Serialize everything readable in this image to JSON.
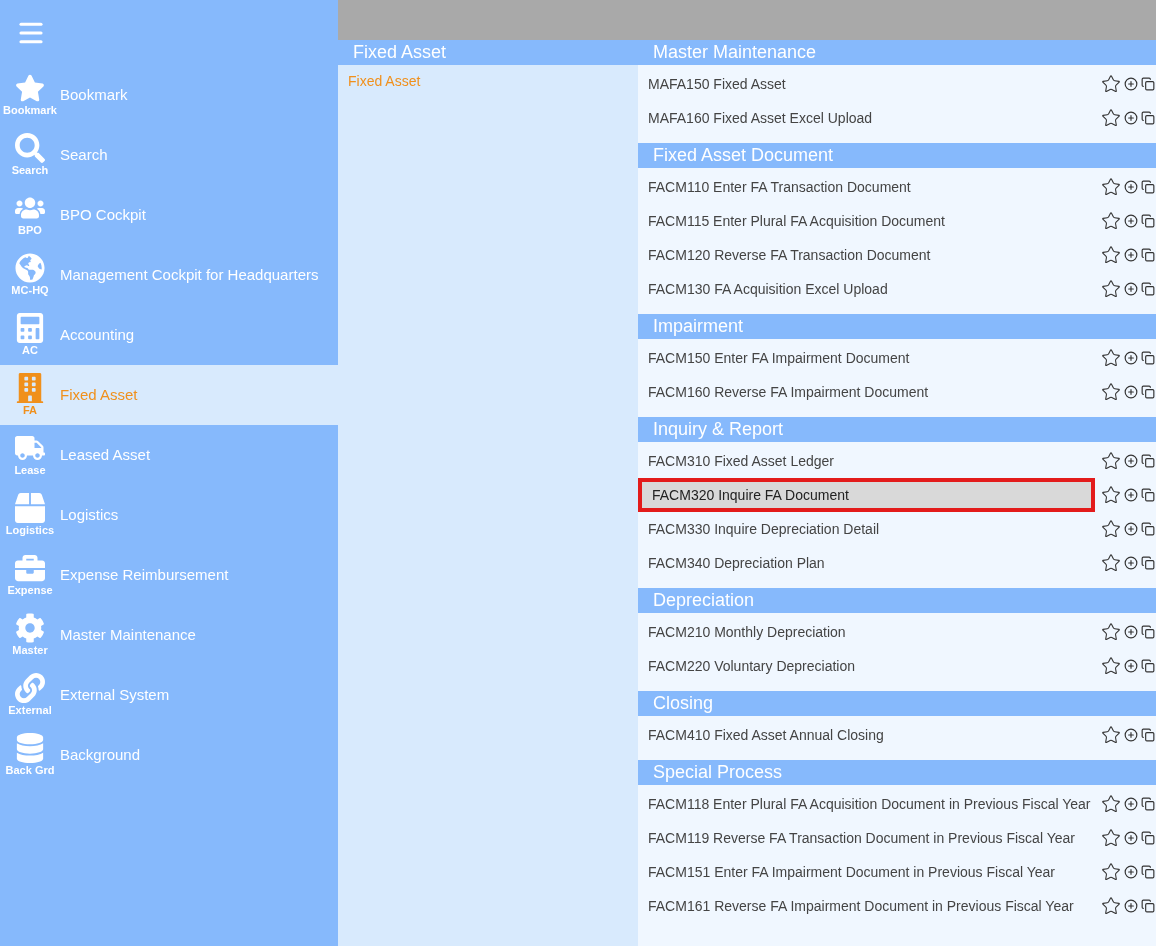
{
  "sidebar": {
    "items": [
      {
        "short_label": "Bookmark",
        "label": "Bookmark",
        "selected": false
      },
      {
        "short_label": "Search",
        "label": "Search",
        "selected": false
      },
      {
        "short_label": "BPO",
        "label": "BPO Cockpit",
        "selected": false
      },
      {
        "short_label": "MC-HQ",
        "label": "Management Cockpit for Headquarters",
        "selected": false
      },
      {
        "short_label": "AC",
        "label": "Accounting",
        "selected": false
      },
      {
        "short_label": "FA",
        "label": "Fixed Asset",
        "selected": true
      },
      {
        "short_label": "Lease",
        "label": "Leased Asset",
        "selected": false
      },
      {
        "short_label": "Logistics",
        "label": "Logistics",
        "selected": false
      },
      {
        "short_label": "Expense",
        "label": "Expense Reimbursement",
        "selected": false
      },
      {
        "short_label": "Master",
        "label": "Master Maintenance",
        "selected": false
      },
      {
        "short_label": "External",
        "label": "External System",
        "selected": false
      },
      {
        "short_label": "Back Grd",
        "label": "Background",
        "selected": false
      }
    ]
  },
  "category_panel": {
    "title": "Fixed Asset",
    "items": [
      {
        "label": "Fixed Asset",
        "selected": true
      }
    ]
  },
  "menu_sections": [
    {
      "title": "Master Maintenance",
      "items": [
        {
          "label": "MAFA150 Fixed Asset",
          "selected": false
        },
        {
          "label": "MAFA160 Fixed Asset Excel Upload",
          "selected": false
        }
      ]
    },
    {
      "title": "Fixed Asset Document",
      "items": [
        {
          "label": "FACM110 Enter FA Transaction Document",
          "selected": false
        },
        {
          "label": "FACM115 Enter Plural FA Acquisition Document",
          "selected": false
        },
        {
          "label": "FACM120 Reverse FA Transaction Document",
          "selected": false
        },
        {
          "label": "FACM130 FA Acquisition Excel Upload",
          "selected": false
        }
      ]
    },
    {
      "title": "Impairment",
      "items": [
        {
          "label": "FACM150 Enter FA Impairment Document",
          "selected": false
        },
        {
          "label": "FACM160 Reverse FA Impairment Document",
          "selected": false
        }
      ]
    },
    {
      "title": "Inquiry & Report",
      "items": [
        {
          "label": "FACM310 Fixed Asset Ledger",
          "selected": false
        },
        {
          "label": "FACM320 Inquire FA Document",
          "selected": true
        },
        {
          "label": "FACM330 Inquire Depreciation Detail",
          "selected": false
        },
        {
          "label": "FACM340 Depreciation Plan",
          "selected": false
        }
      ]
    },
    {
      "title": "Depreciation",
      "items": [
        {
          "label": "FACM210 Monthly Depreciation",
          "selected": false
        },
        {
          "label": "FACM220 Voluntary Depreciation",
          "selected": false
        }
      ]
    },
    {
      "title": "Closing",
      "items": [
        {
          "label": "FACM410 Fixed Asset Annual Closing",
          "selected": false
        }
      ]
    },
    {
      "title": "Special Process",
      "items": [
        {
          "label": "FACM118 Enter Plural FA Acquisition Document in Previous Fiscal Year",
          "selected": false
        },
        {
          "label": "FACM119 Reverse FA Transaction Document in Previous Fiscal Year",
          "selected": false
        },
        {
          "label": "FACM151 Enter FA Impairment Document in Previous Fiscal Year",
          "selected": false
        },
        {
          "label": "FACM161 Reverse FA Impairment Document in Previous Fiscal Year",
          "selected": false
        }
      ]
    }
  ]
}
